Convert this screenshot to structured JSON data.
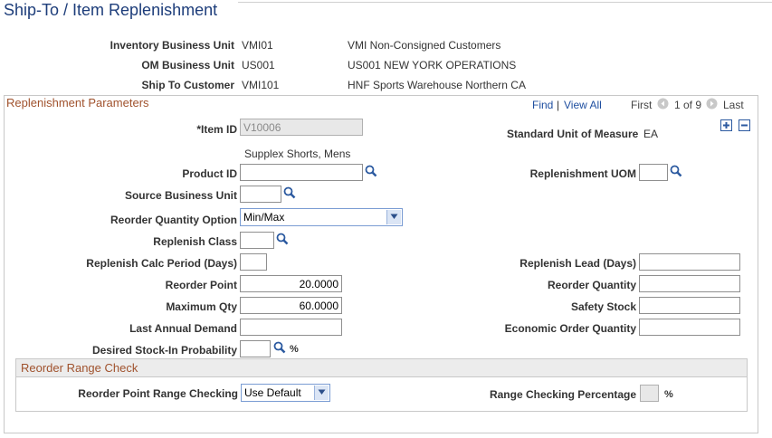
{
  "page": {
    "title": "Ship-To / Item Replenishment"
  },
  "header": {
    "inventory_bu_label": "Inventory Business Unit",
    "inventory_bu_value": "VMI01",
    "inventory_bu_desc": "VMI Non-Consigned Customers",
    "om_bu_label": "OM Business Unit",
    "om_bu_value": "US001",
    "om_bu_desc": "US001 NEW YORK OPERATIONS",
    "ship_to_label": "Ship To Customer",
    "ship_to_value": "VMI101",
    "ship_to_desc": "HNF Sports Warehouse Northern CA"
  },
  "params": {
    "title": "Replenishment Parameters",
    "nav": {
      "find": "Find",
      "sep": "|",
      "view_all": "View All",
      "first": "First",
      "count": "1 of 9",
      "last": "Last"
    },
    "item_id_label": "*Item ID",
    "item_id_value": "V10006",
    "item_desc": "Supplex Shorts, Mens",
    "std_uom_label": "Standard Unit of Measure",
    "std_uom_value": "EA",
    "product_id_label": "Product ID",
    "product_id_value": "",
    "repl_uom_label": "Replenishment UOM",
    "repl_uom_value": "",
    "source_bu_label": "Source Business Unit",
    "source_bu_value": "",
    "reorder_qty_option_label": "Reorder Quantity Option",
    "reorder_qty_option_value": "Min/Max",
    "repl_class_label": "Replenish Class",
    "repl_class_value": "",
    "calc_period_label": "Replenish Calc Period (Days)",
    "calc_period_value": "",
    "lead_label": "Replenish Lead (Days)",
    "lead_value": "",
    "reorder_point_label": "Reorder Point",
    "reorder_point_value": "20.0000",
    "reorder_qty_label": "Reorder Quantity",
    "reorder_qty_value": "",
    "max_qty_label": "Maximum Qty",
    "max_qty_value": "60.0000",
    "safety_label": "Safety Stock",
    "safety_value": "",
    "last_demand_label": "Last Annual Demand",
    "last_demand_value": "",
    "eoq_label": "Economic Order Quantity",
    "eoq_value": "",
    "stock_prob_label": "Desired Stock-In Probability",
    "stock_prob_value": "",
    "pct": "%"
  },
  "range": {
    "title": "Reorder Range Check",
    "checking_label": "Reorder Point Range Checking",
    "checking_value": "Use Default",
    "pct_label": "Range Checking Percentage",
    "pct_value": "",
    "pct": "%"
  }
}
